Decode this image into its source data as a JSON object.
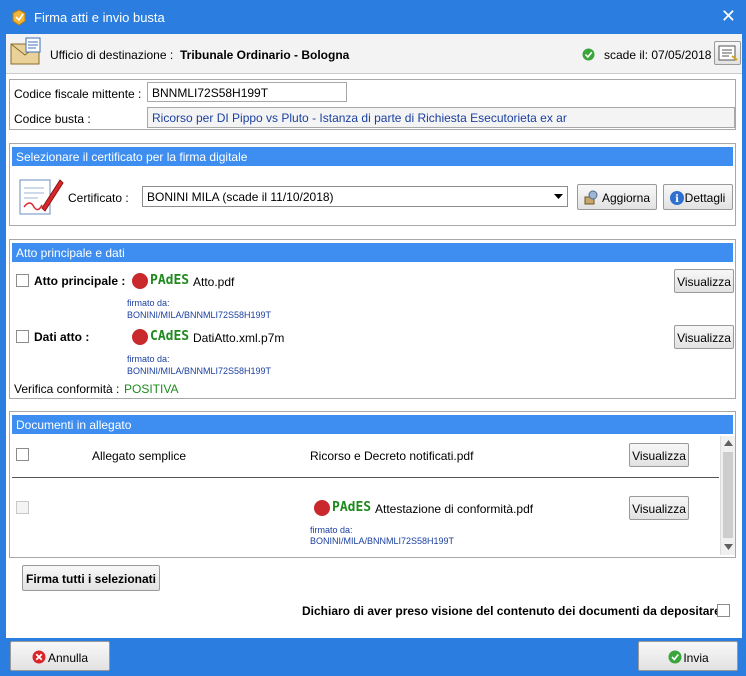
{
  "window": {
    "title": "Firma atti e invio busta",
    "close_glyph": "✕"
  },
  "header": {
    "office_label": "Ufficio di destinazione :",
    "office_value": "Tribunale Ordinario - Bologna",
    "expiry_label": "scade il: 07/05/2018"
  },
  "sender": {
    "cf_label": "Codice fiscale mittente :",
    "cf_value": "BNNMLI72S58H199T",
    "code_label": "Codice  busta :",
    "code_value": "Ricorso per DI Pippo vs Pluto - Istanza di parte di Richiesta Esecutorieta ex ar"
  },
  "certificate": {
    "section_title": "Selezionare il certificato per la firma digitale",
    "label": "Certificato :",
    "selected": "BONINI MILA (scade il 11/10/2018)",
    "refresh_label": "Aggiorna",
    "details_label": "Dettagli"
  },
  "main_act": {
    "section_title": "Atto principale e dati",
    "atto_label": "Atto principale :",
    "atto_sig": "PAdES",
    "atto_file": "Atto.pdf",
    "atto_signed_by": "firmato da:",
    "atto_signer": "BONINI/MILA/BNNMLI72S58H199T",
    "view_label": "Visualizza",
    "dati_label": "Dati atto :",
    "dati_sig": "CAdES",
    "dati_file": "DatiAtto.xml.p7m",
    "dati_signed_by": "firmato da:",
    "dati_signer": "BONINI/MILA/BNNMLI72S58H199T",
    "conformity_label": "Verifica conformità :",
    "conformity_value": "POSITIVA"
  },
  "attachments": {
    "section_title": "Documenti in allegato",
    "rows": [
      {
        "type": "Allegato semplice",
        "file": "Ricorso e Decreto notificati.pdf",
        "view": "Visualizza"
      },
      {
        "type": "",
        "sig": "PAdES",
        "file": "Attestazione di conformità.pdf",
        "signed_by": "firmato da:",
        "signer": "BONINI/MILA/BNNMLI72S58H199T",
        "view": "Visualizza"
      }
    ]
  },
  "actions": {
    "sign_all": "Firma tutti i selezionati",
    "declaration": "Dichiaro di aver preso visione del contenuto dei documenti da depositare",
    "cancel": "Annulla",
    "send": "Invia"
  },
  "colors": {
    "titlebar": "#2b7ee0",
    "section": "#3d8ef0",
    "positive": "#1e8a1e",
    "cancel_icon": "#d9262b",
    "ok_icon": "#3aa53a"
  }
}
